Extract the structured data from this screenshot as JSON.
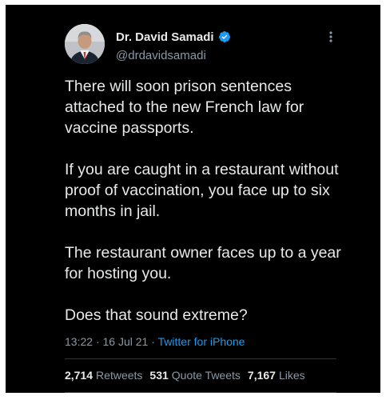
{
  "author": {
    "display_name": "Dr. David Samadi",
    "handle": "@drdavidsamadi",
    "verified": true,
    "avatar_icon": "profile-photo"
  },
  "tweet": {
    "paragraphs": [
      "There will soon prison sentences attached to the new French law for vaccine passports.",
      "If you are caught in a restaurant without proof of vaccination, you face up to six months in jail.",
      "The restaurant owner faces up to a year for hosting you.",
      "Does that sound extreme?"
    ],
    "time": "13:22",
    "date": "16 Jul 21",
    "separator": "·",
    "source": "Twitter for iPhone"
  },
  "stats": {
    "retweets_count": "2,714",
    "retweets_label": "Retweets",
    "quotes_count": "531",
    "quotes_label": "Quote Tweets",
    "likes_count": "7,167",
    "likes_label": "Likes"
  },
  "colors": {
    "background": "#000000",
    "text": "#e7e9ea",
    "secondary": "#8b98a5",
    "accent": "#1d9bf0"
  }
}
